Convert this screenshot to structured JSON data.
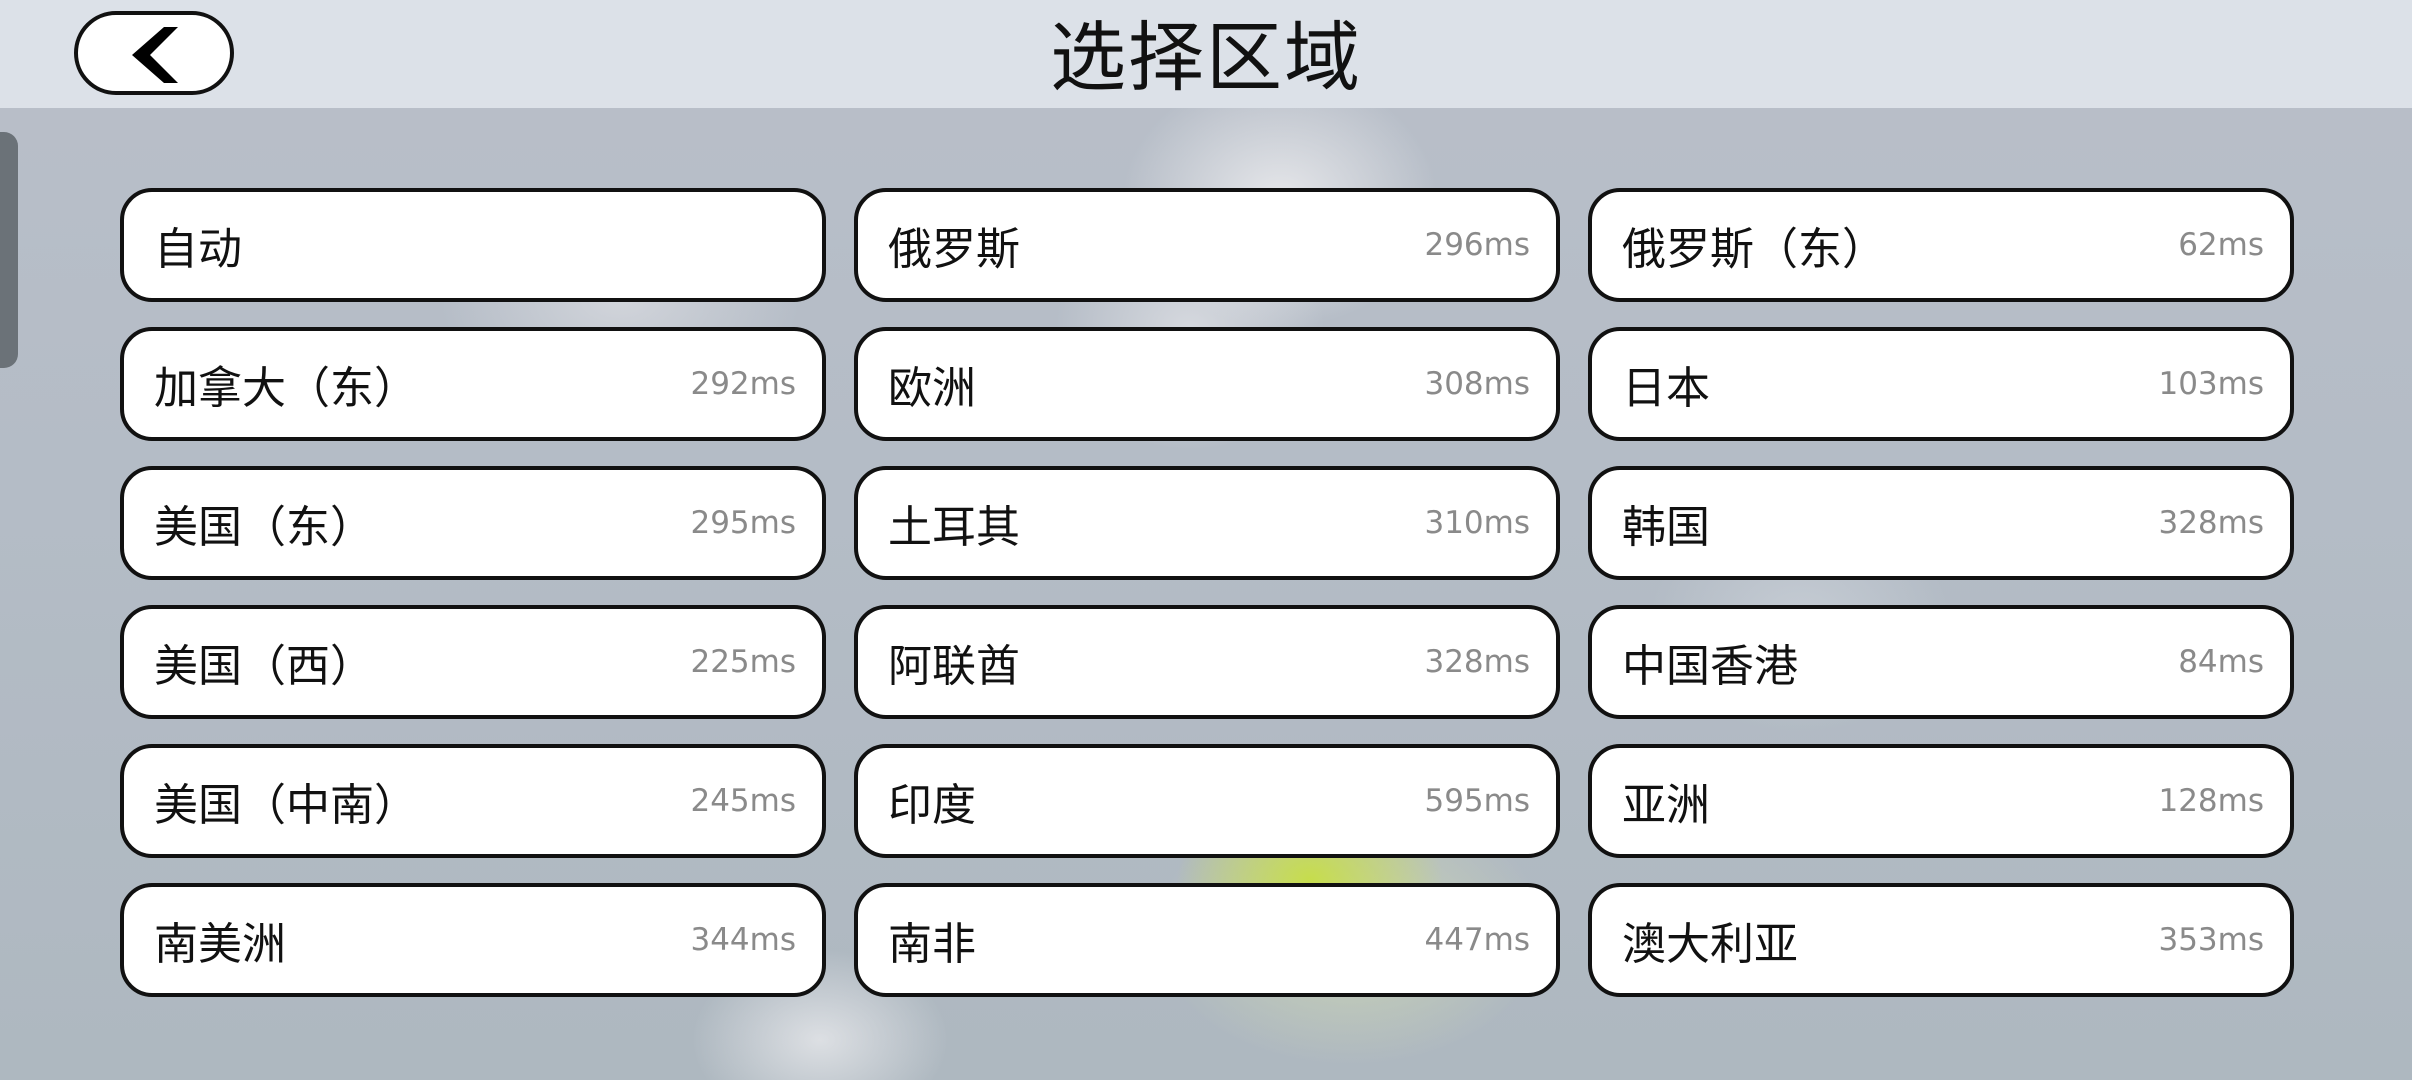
{
  "header": {
    "title": "选择区域",
    "back_icon": "chevron-left-icon"
  },
  "regions": [
    {
      "name": "自动",
      "ping": ""
    },
    {
      "name": "俄罗斯",
      "ping": "296ms"
    },
    {
      "name": "俄罗斯（东）",
      "ping": "62ms"
    },
    {
      "name": "加拿大（东）",
      "ping": "292ms"
    },
    {
      "name": "欧洲",
      "ping": "308ms"
    },
    {
      "name": "日本",
      "ping": "103ms"
    },
    {
      "name": "美国（东）",
      "ping": "295ms"
    },
    {
      "name": "土耳其",
      "ping": "310ms"
    },
    {
      "name": "韩国",
      "ping": "328ms"
    },
    {
      "name": "美国（西）",
      "ping": "225ms"
    },
    {
      "name": "阿联酋",
      "ping": "328ms"
    },
    {
      "name": "中国香港",
      "ping": "84ms"
    },
    {
      "name": "美国（中南）",
      "ping": "245ms"
    },
    {
      "name": "印度",
      "ping": "595ms"
    },
    {
      "name": "亚洲",
      "ping": "128ms"
    },
    {
      "name": "南美洲",
      "ping": "344ms"
    },
    {
      "name": "南非",
      "ping": "447ms"
    },
    {
      "name": "澳大利亚",
      "ping": "353ms"
    }
  ],
  "colors": {
    "header_bg": "#dce1e8",
    "item_bg": "#ffffff",
    "item_border": "#111111",
    "ping_text": "#8a8a8a"
  }
}
